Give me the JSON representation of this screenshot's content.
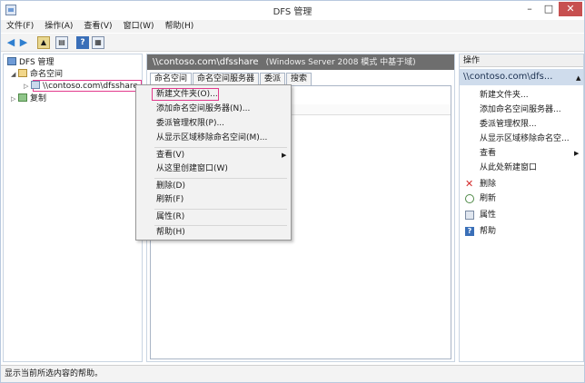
{
  "window": {
    "title": "DFS 管理",
    "controls": {
      "minimize": "–",
      "maximize": "□",
      "close": "✕"
    }
  },
  "menubar": [
    "文件(F)",
    "操作(A)",
    "查看(V)",
    "窗口(W)",
    "帮助(H)"
  ],
  "toolbar": {
    "icons": [
      "back-arrow-icon",
      "forward-arrow-icon",
      "up-folder-icon",
      "show-tree-icon",
      "help-icon",
      "grid-icon"
    ],
    "glyphs": {
      "back": "◀",
      "forward": "▶",
      "up": "▲",
      "tree": "▤",
      "help": "?",
      "grid": "▦"
    }
  },
  "tree": {
    "root": "DFS 管理",
    "namespaces": "命名空间",
    "share": "\\\\contoso.com\\dfsshare",
    "replication": "复制",
    "expand_glyph": "◢",
    "collapsed_glyph": "▷"
  },
  "center": {
    "header_path": "\\\\contoso.com\\dfsshare",
    "header_sub": "(Windows Server 2008 模式 中基于域)",
    "tabs": [
      "命名空间",
      "命名空间服务器",
      "委派",
      "搜索"
    ],
    "active_tab": 0
  },
  "context_menu": {
    "items": [
      {
        "label": "新建文件夹(O)...",
        "highlighted": true
      },
      {
        "label": "添加命名空间服务器(N)..."
      },
      {
        "label": "委派管理权限(P)..."
      },
      {
        "label": "从显示区域移除命名空间(M)..."
      },
      {
        "label": "查看(V)",
        "submenu": true
      },
      {
        "label": "从这里创建窗口(W)"
      },
      {
        "label": "删除(D)"
      },
      {
        "label": "刷新(F)"
      },
      {
        "label": "属性(R)"
      },
      {
        "label": "帮助(H)"
      }
    ],
    "submenu_glyph": "▶"
  },
  "actions": {
    "title": "操作",
    "group": "\\\\contoso.com\\dfs...",
    "group_glyph": "▲",
    "items": [
      {
        "label": "新建文件夹..."
      },
      {
        "label": "添加命名空间服务器..."
      },
      {
        "label": "委派管理权限..."
      },
      {
        "label": "从显示区域移除命名空..."
      },
      {
        "label": "查看",
        "submenu": true
      },
      {
        "label": "从此处新建窗口"
      },
      {
        "label": "删除",
        "icon": "delete-icon",
        "glyph": "✕"
      },
      {
        "label": "刷新",
        "icon": "refresh-icon"
      },
      {
        "label": "属性",
        "icon": "properties-icon"
      },
      {
        "label": "帮助",
        "icon": "help-icon",
        "glyph": "?"
      }
    ],
    "submenu_glyph": "▶"
  },
  "status": "显示当前所选内容的帮助。",
  "colors": {
    "header_bg": "#6e6e6e",
    "actions_group_bg": "#cfdcec",
    "highlight_border": "#e23a8c",
    "close_button": "#c75050"
  }
}
